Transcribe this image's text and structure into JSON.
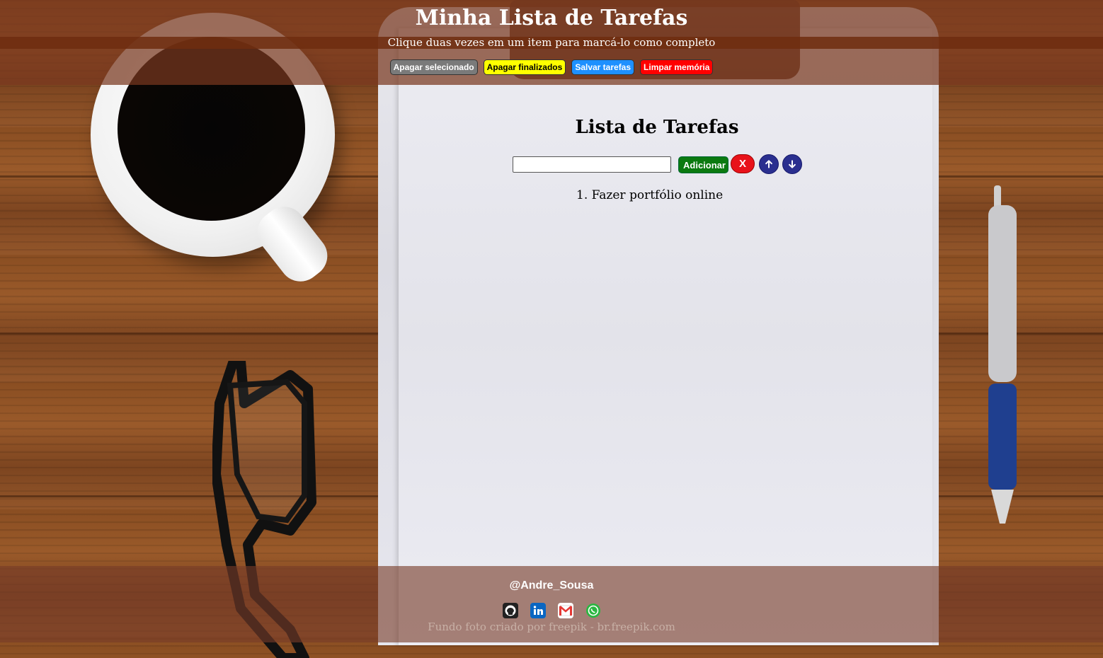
{
  "header": {
    "title": "Minha Lista de Tarefas",
    "subtitle": "Clique duas vezes em um item para marcá-lo como completo",
    "buttons": {
      "delete_selected": "Apagar selecionado",
      "delete_finished": "Apagar finalizados",
      "save_tasks": "Salvar tarefas",
      "clear_memory": "Limpar memória"
    }
  },
  "main": {
    "heading": "Lista de Tarefas",
    "input_value": "",
    "add_label": "Adicionar",
    "delete_label": "X",
    "tasks": [
      {
        "number": "1.",
        "text": "Fazer portfólio online"
      }
    ]
  },
  "footer": {
    "handle": "@Andre_Sousa",
    "socials": [
      "github-icon",
      "linkedin-icon",
      "gmail-icon",
      "whatsapp-icon"
    ],
    "credit": "Fundo foto criado por freepik - br.freepik.com"
  },
  "colors": {
    "header_bg": "#78371e",
    "btn_gray": "#7a7a7a",
    "btn_yellow": "#ffff00",
    "btn_blue": "#1e90ff",
    "btn_red": "#ff0000",
    "add_green": "#0b7a10",
    "arrow_blue": "#2a2f8f"
  }
}
